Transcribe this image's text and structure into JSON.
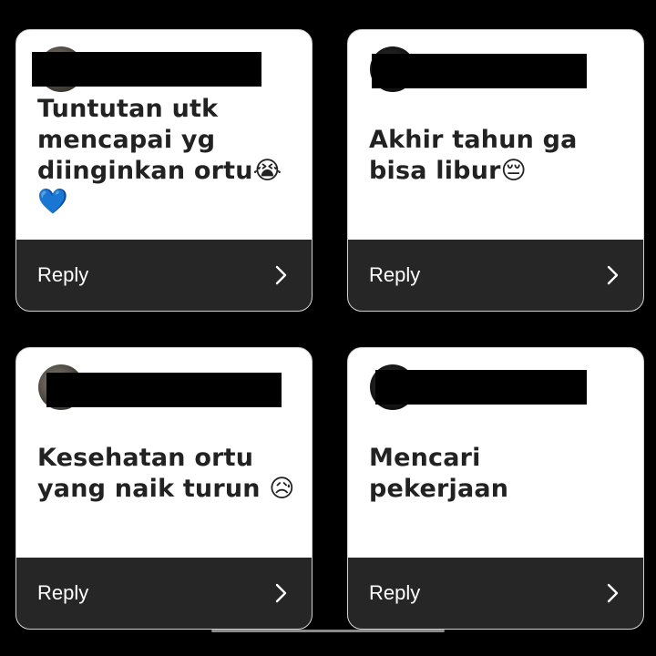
{
  "cards": [
    {
      "message": "Tuntutan utk\nmencapai yg\ndiinginkan ortu😭💙",
      "reply_label": "Reply",
      "chevron_icon": "chevron-right-icon"
    },
    {
      "message": "Akhir tahun ga\nbisa libur😔",
      "reply_label": "Reply",
      "chevron_icon": "chevron-right-icon"
    },
    {
      "message": "Kesehatan ortu\nyang naik turun 😥",
      "reply_label": "Reply",
      "chevron_icon": "chevron-right-icon"
    },
    {
      "message": "Mencari pekerjaan",
      "reply_label": "Reply",
      "chevron_icon": "chevron-right-icon"
    }
  ],
  "colors": {
    "background": "#000000",
    "card": "#ffffff",
    "reply_bar": "#262626",
    "message_text": "#222222"
  }
}
